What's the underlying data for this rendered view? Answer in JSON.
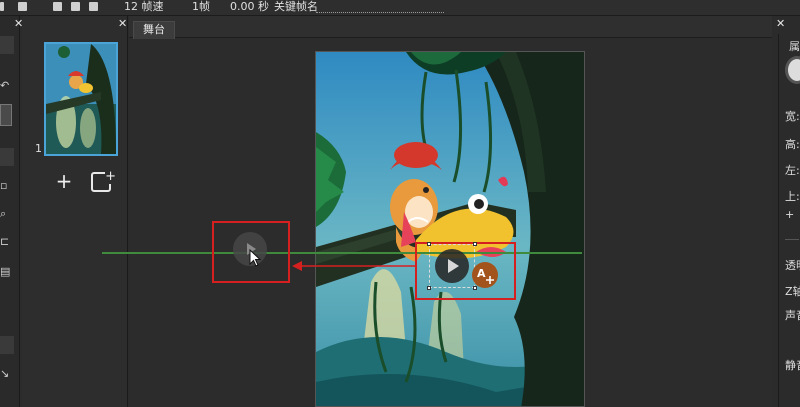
{
  "toolbar": {
    "fps": "12 帧速",
    "frame": "1帧",
    "time": "0.00 秒",
    "keyframe_label": "关键帧名"
  },
  "scenes": {
    "thumb_number": "1",
    "add_label": "+"
  },
  "stage": {
    "tab_label": "舞台"
  },
  "properties": {
    "title": "属",
    "width": "宽:",
    "height": "高:",
    "left": "左:",
    "top": "上:",
    "plus": "+",
    "opacity": "透明",
    "z": "Z轴",
    "sound": "声音",
    "mute": "静音"
  },
  "colors": {
    "highlight_box": "#d62020",
    "timeline_line": "#3f8a3c",
    "thumb_border": "#4aa4d8"
  }
}
